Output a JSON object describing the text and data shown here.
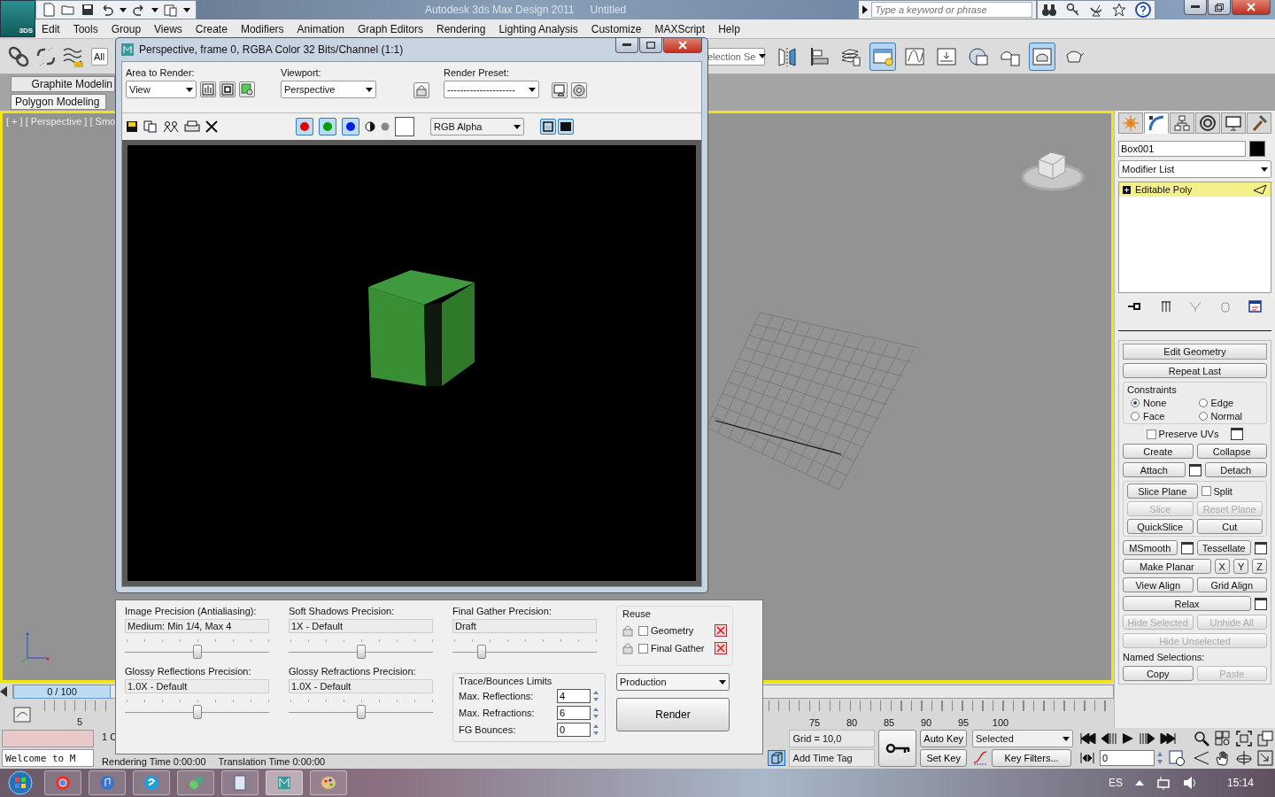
{
  "app_button": {
    "label": "3DS"
  },
  "title_bar": {
    "app_title": "Autodesk 3ds Max Design 2011",
    "document_title": "Untitled",
    "search": {
      "placeholder": "Type a keyword or phrase"
    }
  },
  "menu": [
    "Edit",
    "Tools",
    "Group",
    "Views",
    "Create",
    "Modifiers",
    "Animation",
    "Graph Editors",
    "Rendering",
    "Lighting Analysis",
    "Customize",
    "MAXScript",
    "Help"
  ],
  "main_toolbar": {
    "selection_filter": "All",
    "named_selection": "election Se",
    "tools": [
      {
        "kind": "mirror",
        "selected": false
      },
      {
        "kind": "align",
        "selected": false
      },
      {
        "kind": "layers",
        "selected": false
      },
      {
        "kind": "explorer",
        "selected": true
      },
      {
        "kind": "curves",
        "selected": false
      },
      {
        "kind": "schematic",
        "selected": false
      },
      {
        "kind": "material",
        "selected": false
      },
      {
        "kind": "setup",
        "selected": false
      },
      {
        "kind": "frame",
        "selected": true
      },
      {
        "kind": "render",
        "selected": false
      }
    ]
  },
  "ribbon": {
    "tab": "Graphite Modelin",
    "panel": "Polygon Modeling"
  },
  "viewport": {
    "label": "[ + ] [ Perspective ] [ Smo"
  },
  "command_panel": {
    "tabs": [
      {
        "kind": "create",
        "selected": false
      },
      {
        "kind": "modify",
        "selected": true
      },
      {
        "kind": "hierarchy",
        "selected": false
      },
      {
        "kind": "motion",
        "selected": false
      },
      {
        "kind": "display",
        "selected": false
      },
      {
        "kind": "utilities",
        "selected": false
      }
    ],
    "object_name": "Box001",
    "modifier_list": "Modifier List",
    "stack": [
      {
        "label": "Editable Poly",
        "selected": true
      }
    ],
    "rollout": {
      "title": "Edit Geometry",
      "repeat_last": "Repeat Last",
      "constraints": {
        "title": "Constraints",
        "options": [
          {
            "label": "None",
            "selected": true
          },
          {
            "label": "Edge",
            "selected": false
          },
          {
            "label": "Face",
            "selected": false
          },
          {
            "label": "Normal",
            "selected": false
          }
        ]
      },
      "preserve_uvs": {
        "label": "Preserve UVs",
        "checked": false
      },
      "button_rows": [
        [
          {
            "kind": "button",
            "label": "Create",
            "disabled": false,
            "settings": false
          },
          {
            "kind": "button",
            "label": "Collapse",
            "disabled": false,
            "settings": false
          }
        ],
        [
          {
            "kind": "button",
            "label": "Attach",
            "disabled": false,
            "settings": true
          },
          {
            "kind": "button",
            "label": "Detach",
            "disabled": false,
            "settings": false
          }
        ]
      ],
      "slice_rows": [
        [
          {
            "kind": "button",
            "label": "Slice Plane",
            "disabled": false,
            "settings": false
          },
          {
            "kind": "checkbox",
            "label": "Split",
            "checked": false
          }
        ],
        [
          {
            "kind": "button",
            "label": "Slice",
            "disabled": true,
            "settings": false
          },
          {
            "kind": "button",
            "label": "Reset Plane",
            "disabled": true,
            "settings": false
          }
        ],
        [
          {
            "kind": "button",
            "label": "QuickSlice",
            "disabled": false,
            "settings": false
          },
          {
            "kind": "button",
            "label": "Cut",
            "disabled": false,
            "settings": false
          }
        ]
      ],
      "more_rows": [
        [
          {
            "kind": "button",
            "label": "MSmooth",
            "disabled": false,
            "settings": true
          },
          {
            "kind": "button",
            "label": "Tessellate",
            "disabled": false,
            "settings": true
          }
        ],
        [
          {
            "kind": "button",
            "label": "Make Planar",
            "disabled": false,
            "settings": false
          },
          {
            "kind": "axis",
            "label": "X",
            "disabled": false
          },
          {
            "kind": "axis",
            "label": "Y",
            "disabled": false
          },
          {
            "kind": "axis",
            "label": "Z",
            "disabled": false
          }
        ],
        [
          {
            "kind": "button",
            "label": "View Align",
            "disabled": false,
            "settings": false
          },
          {
            "kind": "button",
            "label": "Grid Align",
            "disabled": false,
            "settings": false
          }
        ],
        [
          {
            "kind": "button",
            "label": "Relax",
            "disabled": false,
            "settings": true
          }
        ],
        [
          {
            "kind": "button",
            "label": "Hide Selected",
            "disabled": true,
            "settings": false
          },
          {
            "kind": "button",
            "label": "Unhide All",
            "disabled": true,
            "settings": false
          }
        ],
        [
          {
            "kind": "button",
            "label": "Hide Unselected",
            "disabled": true,
            "settings": false
          }
        ]
      ],
      "named_selections": {
        "label": "Named Selections:",
        "buttons": [
          {
            "label": "Copy",
            "disabled": false
          },
          {
            "label": "Paste",
            "disabled": true
          }
        ]
      }
    }
  },
  "timeline": {
    "position": "0 / 100",
    "level": 0,
    "left_ticks": [
      "5"
    ],
    "right_ticks": [
      "75",
      "80",
      "85",
      "90",
      "95",
      "100"
    ]
  },
  "status": {
    "welcome": "Welcome to M",
    "selection_info": "1 C",
    "render_time": "Rendering Time  0:00:00",
    "translation_time": "Translation Time  0:00:00",
    "isolate_on": true,
    "grid": "Grid = 10,0",
    "time_tag": "Add Time Tag",
    "auto_key": {
      "label": "Auto Key",
      "on": false
    },
    "set_key": "Set Key",
    "key_mode": "Selected",
    "key_filters": "Key Filters...",
    "frame": "0"
  },
  "render_window": {
    "title": "Perspective, frame 0, RGBA Color 32 Bits/Channel (1:1)",
    "area_label": "Area to Render:",
    "area": "View",
    "viewport_label": "Viewport:",
    "viewport": "Perspective",
    "preset_label": "Render Preset:",
    "preset": "---------------------",
    "channels": [
      {
        "color": "#e00000",
        "selected": true
      },
      {
        "color": "#00a000",
        "selected": true
      },
      {
        "color": "#0020e0",
        "selected": true
      }
    ],
    "display": "RGB Alpha",
    "view_toggles": [
      {
        "selected": true
      },
      {
        "selected": true
      }
    ]
  },
  "render_settings": {
    "precisions": [
      {
        "label": "Image Precision (Antialiasing):",
        "value": "Medium: Min 1/4, Max 4",
        "level": 0.5
      },
      {
        "label": "Soft Shadows Precision:",
        "value": "1X - Default",
        "level": 0.5
      },
      {
        "label": "Final Gather Precision:",
        "value": "Draft",
        "level": 0.2
      },
      {
        "label": "Glossy Reflections Precision:",
        "value": "1.0X - Default",
        "level": 0.5
      },
      {
        "label": "Glossy Refractions Precision:",
        "value": "1.0X - Default",
        "level": 0.5
      }
    ],
    "limits": {
      "title": "Trace/Bounces Limits",
      "fields": [
        {
          "label": "Max. Reflections:",
          "value": "4"
        },
        {
          "label": "Max. Refractions:",
          "value": "6"
        },
        {
          "label": "FG Bounces:",
          "value": "0"
        }
      ]
    },
    "reuse": {
      "title": "Reuse",
      "items": [
        {
          "label": "Geometry",
          "checked": false
        },
        {
          "label": "Final Gather",
          "checked": false
        }
      ]
    },
    "mode": "Production",
    "render_button": "Render"
  },
  "taskbar": {
    "apps": [
      {
        "kind": "browser",
        "selected": false
      },
      {
        "kind": "music",
        "selected": false
      },
      {
        "kind": "phone",
        "selected": false
      },
      {
        "kind": "tool",
        "selected": false
      },
      {
        "kind": "notes",
        "selected": false
      },
      {
        "kind": "max",
        "selected": true
      },
      {
        "kind": "paint",
        "selected": false
      }
    ],
    "language": "ES",
    "clock": "15:14"
  }
}
